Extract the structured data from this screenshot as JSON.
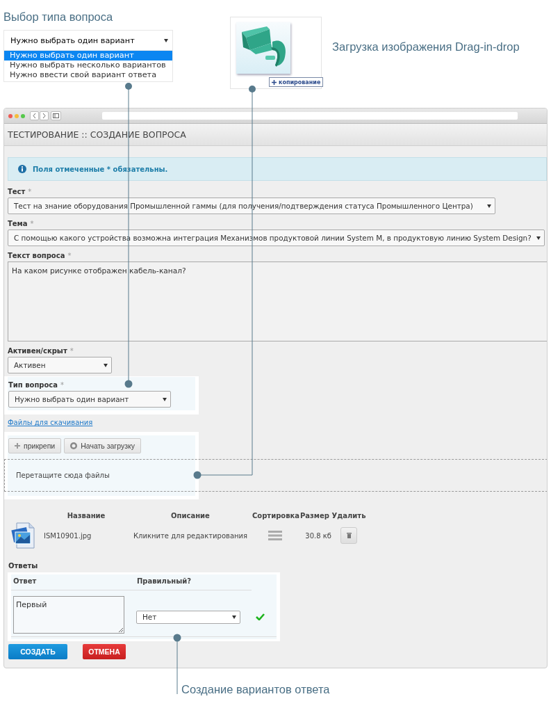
{
  "question_type_callout": {
    "title": "Выбор типа вопроса",
    "value": "Нужно выбрать один вариант",
    "options": [
      {
        "label": "Нужно выбрать один вариант",
        "selected": true
      },
      {
        "label": "Нужно выбрать несколько вариантов",
        "selected": false
      },
      {
        "label": "Нужно ввести свой вариант ответа",
        "selected": false
      }
    ]
  },
  "image_callout": {
    "copy_button": "копирование",
    "caption": "Загрузка изображения Drag-in-drop"
  },
  "window": {
    "title": "ТЕСТИРОВАНИЕ :: СОЗДАНИЕ ВОПРОСА",
    "alert": "Поля отмеченные * обязательны.",
    "fields": [
      {
        "label": "Тест",
        "required_mark": "*",
        "kind": "select",
        "value": "Тест на знание оборудования Промышленной гаммы (для получения/подтверждения статуса Промышленного Центра)",
        "highlighted": false
      },
      {
        "label": "Тема",
        "required_mark": "*",
        "kind": "select",
        "value": "С помощью какого устройства возможна интеграция Механизмов продуктовой линии System M, в продуктовую линию System Design?",
        "highlighted": false
      },
      {
        "label": "Текст вопроса",
        "required_mark": "*",
        "kind": "textarea",
        "value": "На каком рисунке отображен кабель-канал?",
        "highlighted": false
      },
      {
        "label": "Активен/скрыт",
        "required_mark": "*",
        "kind": "select",
        "value": "Активен",
        "highlighted": false
      },
      {
        "label": "Тип вопроса",
        "required_mark": "*",
        "kind": "select",
        "value": "Нужно выбрать один вариант",
        "highlighted": true
      }
    ],
    "files_link": "Файлы для скачивания",
    "upload_buttons": [
      {
        "label": "прикрепи",
        "kind": "add"
      },
      {
        "label": "Начать загрузку",
        "kind": "start"
      }
    ],
    "dropzone": "Перетащите сюда файлы",
    "file_columns": [
      "Название",
      "Описание",
      "Сортировка",
      "Размер",
      "Удалить"
    ],
    "files": [
      {
        "name": "ISM10901.jpg",
        "description": "Кликните для редактирования",
        "size": "30.8 кб"
      }
    ],
    "answers": {
      "title": "Ответы",
      "columns": [
        "Ответ",
        "Правильный?"
      ],
      "rows": [
        {
          "answer": "Первый",
          "correct": "Нет"
        }
      ]
    },
    "buttons": [
      {
        "label": "СОЗДАТЬ",
        "kind": "primary"
      },
      {
        "label": "ОТМЕНА",
        "kind": "danger"
      }
    ]
  },
  "answers_caption": "Создание вариантов ответа"
}
